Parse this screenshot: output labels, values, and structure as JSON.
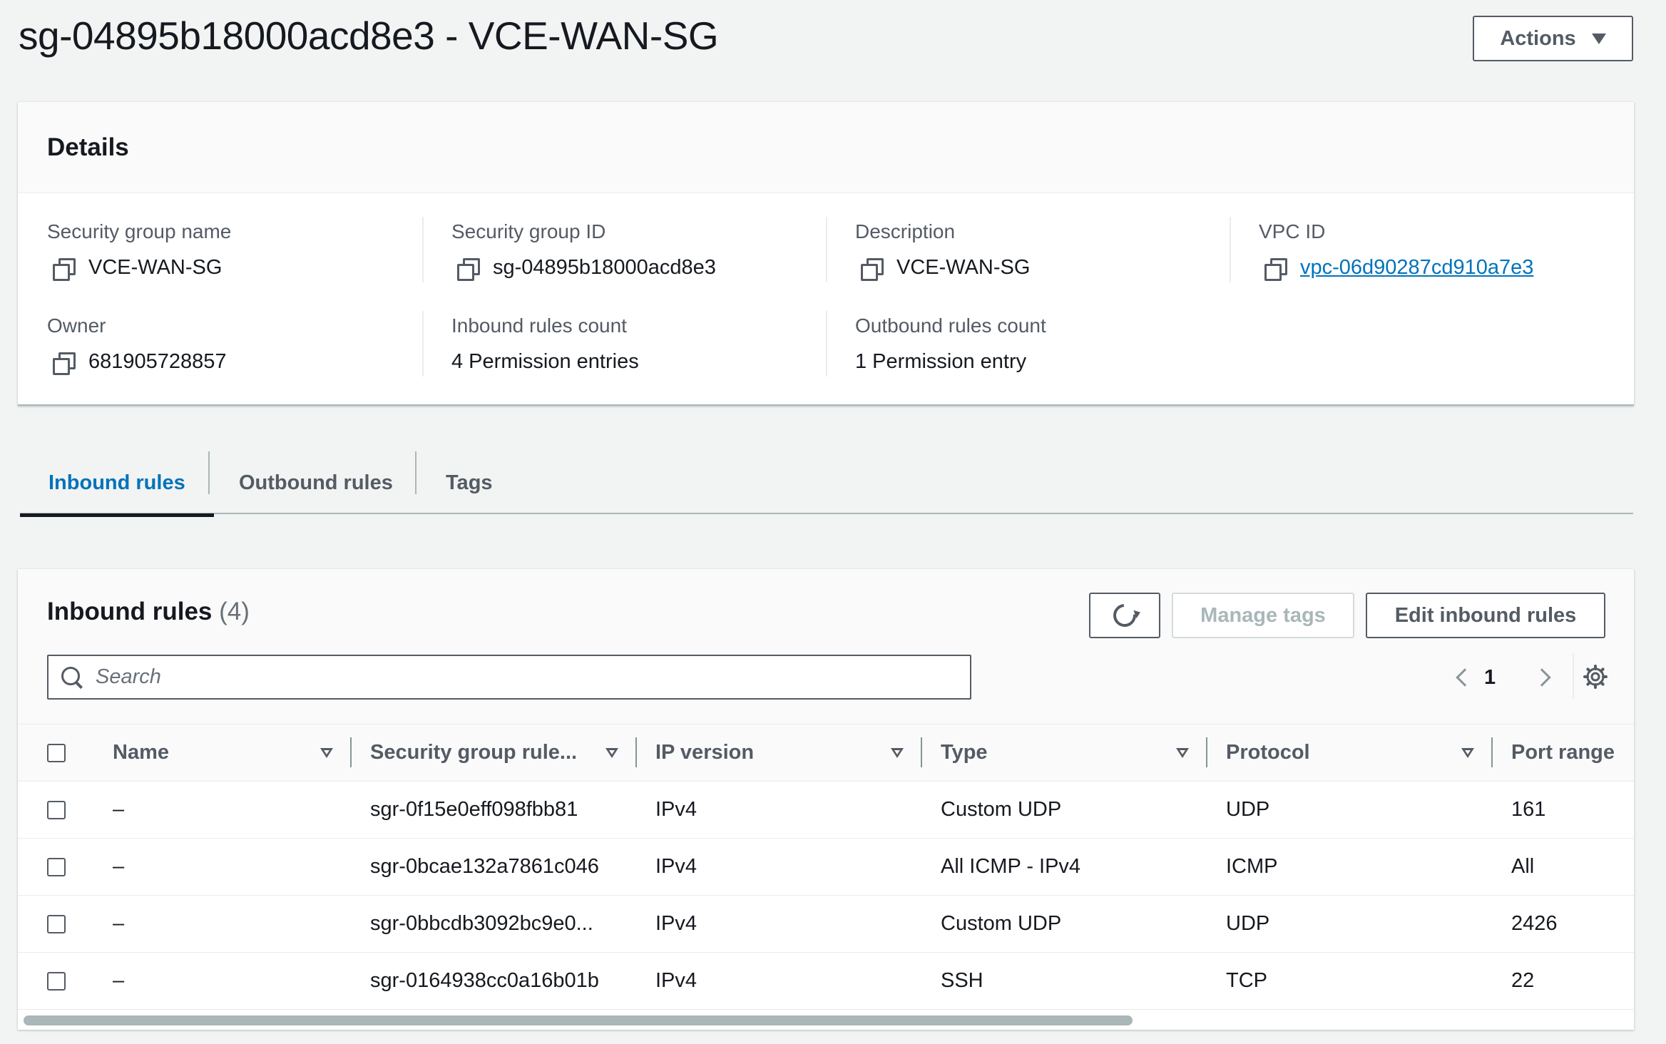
{
  "page": {
    "title": "sg-04895b18000acd8e3 - VCE-WAN-SG",
    "actions_label": "Actions"
  },
  "details": {
    "heading": "Details",
    "fields": {
      "sg_name": {
        "label": "Security group name",
        "value": "VCE-WAN-SG"
      },
      "sg_id": {
        "label": "Security group ID",
        "value": "sg-04895b18000acd8e3"
      },
      "description": {
        "label": "Description",
        "value": "VCE-WAN-SG"
      },
      "vpc_id": {
        "label": "VPC ID",
        "value": "vpc-06d90287cd910a7e3"
      },
      "owner": {
        "label": "Owner",
        "value": "681905728857"
      },
      "inbound_count": {
        "label": "Inbound rules count",
        "value": "4 Permission entries"
      },
      "outbound_count": {
        "label": "Outbound rules count",
        "value": "1 Permission entry"
      }
    }
  },
  "tabs": [
    {
      "label": "Inbound rules",
      "active": true
    },
    {
      "label": "Outbound rules",
      "active": false
    },
    {
      "label": "Tags",
      "active": false
    }
  ],
  "inbound": {
    "title": "Inbound rules",
    "count": "(4)",
    "manage_tags_label": "Manage tags",
    "edit_label": "Edit inbound rules",
    "search_placeholder": "Search",
    "page_number": "1",
    "columns": [
      "Name",
      "Security group rule...",
      "IP version",
      "Type",
      "Protocol",
      "Port range"
    ],
    "rows": [
      {
        "name": "–",
        "rule_id": "sgr-0f15e0eff098fbb81",
        "ip_version": "IPv4",
        "type": "Custom UDP",
        "protocol": "UDP",
        "port_range": "161"
      },
      {
        "name": "–",
        "rule_id": "sgr-0bcae132a7861c046",
        "ip_version": "IPv4",
        "type": "All ICMP - IPv4",
        "protocol": "ICMP",
        "port_range": "All"
      },
      {
        "name": "–",
        "rule_id": "sgr-0bbcdb3092bc9e0...",
        "ip_version": "IPv4",
        "type": "Custom UDP",
        "protocol": "UDP",
        "port_range": "2426"
      },
      {
        "name": "–",
        "rule_id": "sgr-0164938cc0a16b01b",
        "ip_version": "IPv4",
        "type": "SSH",
        "protocol": "TCP",
        "port_range": "22"
      }
    ]
  },
  "colors": {
    "link": "#0073bb",
    "text": "#16191f",
    "secondary": "#545b64",
    "background": "#f2f3f3"
  }
}
